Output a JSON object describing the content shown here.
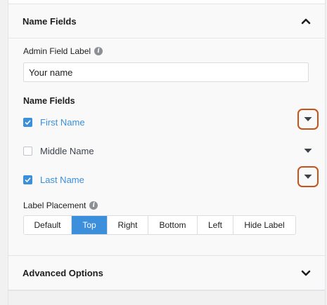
{
  "sections": {
    "name_fields": {
      "title": "Name Fields",
      "expanded": true
    },
    "advanced": {
      "title": "Advanced Options",
      "expanded": false
    }
  },
  "admin_label": {
    "label": "Admin Field Label",
    "value": "Your name"
  },
  "name_fields_group": {
    "title": "Name Fields",
    "items": [
      {
        "label": "First Name",
        "checked": true
      },
      {
        "label": "Middle Name",
        "checked": false
      },
      {
        "label": "Last Name",
        "checked": true
      }
    ]
  },
  "label_placement": {
    "label": "Label Placement",
    "options": [
      "Default",
      "Top",
      "Right",
      "Bottom",
      "Left",
      "Hide Label"
    ],
    "selected": "Top"
  },
  "colors": {
    "accent": "#3b8fdb",
    "highlight_outline": "#c9521a"
  },
  "icons": {
    "collapse": "chevron-up-icon",
    "expand": "chevron-down-icon",
    "dropdown": "caret-down-icon",
    "info": "info-icon",
    "check": "checkmark-icon"
  }
}
